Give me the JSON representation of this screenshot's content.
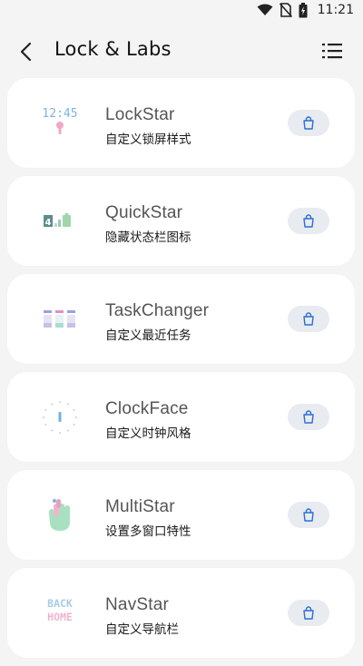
{
  "status_bar": {
    "time": "11:21"
  },
  "header": {
    "title": "Lock & Labs"
  },
  "apps": [
    {
      "name": "LockStar",
      "description": "自定义锁屏样式",
      "icon": "lockstar-icon"
    },
    {
      "name": "QuickStar",
      "description": "隐藏状态栏图标",
      "icon": "quickstar-icon"
    },
    {
      "name": "TaskChanger",
      "description": "自定义最近任务",
      "icon": "taskchanger-icon"
    },
    {
      "name": "ClockFace",
      "description": "自定义时钟风格",
      "icon": "clockface-icon"
    },
    {
      "name": "MultiStar",
      "description": "设置多窗口特性",
      "icon": "multistar-icon"
    },
    {
      "name": "NavStar",
      "description": "自定义导航栏",
      "icon": "navstar-icon"
    }
  ],
  "lockstar_icon_text": "12:45",
  "navstar_icon_text": [
    "BACK",
    "HOME"
  ],
  "colors": {
    "background": "#f4f4f4",
    "card": "#ffffff",
    "button": "#e8ebef",
    "accent_blue": "#2b6fd6"
  }
}
